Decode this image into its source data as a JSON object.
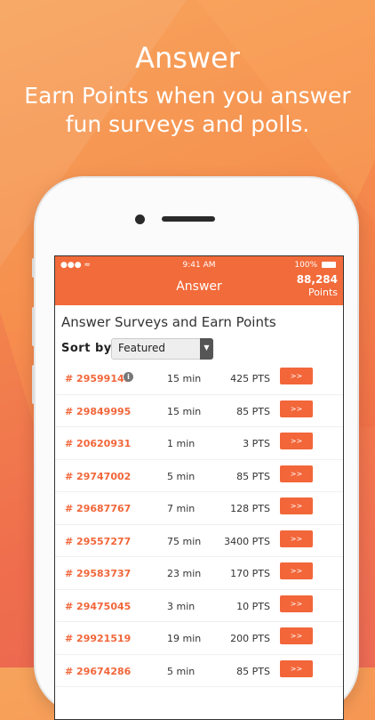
{
  "promo": {
    "title": "Answer",
    "subtitle_line1": "Earn Points when you answer",
    "subtitle_line2": "fun surveys and polls."
  },
  "status_bar": {
    "time": "9:41 AM",
    "battery": "100%"
  },
  "app_bar": {
    "title": "Answer",
    "points_value": "88,284",
    "points_label": "Points"
  },
  "main": {
    "heading": "Answer Surveys and Earn Points",
    "sort_label": "Sort by:",
    "sort_value": "Featured",
    "go_label": ">>",
    "surveys": [
      {
        "id": "# 29599148",
        "duration": "15 min",
        "points": "425 PTS"
      },
      {
        "id": "# 29849995",
        "duration": "15 min",
        "points": "85 PTS"
      },
      {
        "id": "# 20620931",
        "duration": "1 min",
        "points": "3 PTS"
      },
      {
        "id": "# 29747002",
        "duration": "5 min",
        "points": "85 PTS"
      },
      {
        "id": "# 29687767",
        "duration": "7 min",
        "points": "128 PTS"
      },
      {
        "id": "# 29557277",
        "duration": "75 min",
        "points": "3400 PTS"
      },
      {
        "id": "# 29583737",
        "duration": "23 min",
        "points": "170 PTS"
      },
      {
        "id": "# 29475045",
        "duration": "3 min",
        "points": "10 PTS"
      },
      {
        "id": "# 29921519",
        "duration": "19 min",
        "points": "200 PTS"
      },
      {
        "id": "# 29674286",
        "duration": "5 min",
        "points": "85 PTS"
      }
    ]
  }
}
